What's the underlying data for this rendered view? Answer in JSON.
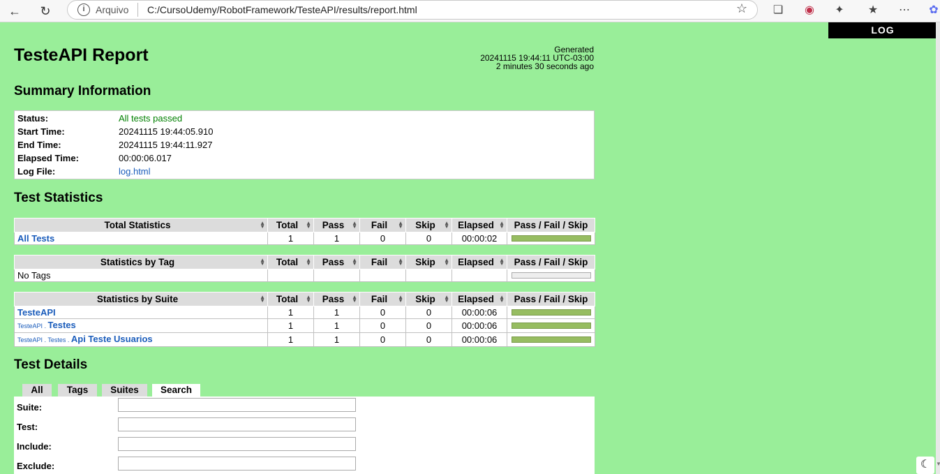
{
  "browser": {
    "url_scheme": "Arquivo",
    "url": "C:/CursoUdemy/RobotFramework/TesteAPI/results/report.html"
  },
  "log_link": "LOG",
  "header": {
    "title": "TesteAPI Report",
    "generated_label": "Generated",
    "generated_time": "20241115 19:44:11 UTC-03:00",
    "generated_ago": "2 minutes 30 seconds ago"
  },
  "summary": {
    "heading": "Summary Information",
    "rows": [
      {
        "label": "Status:",
        "value": "All tests passed"
      },
      {
        "label": "Start Time:",
        "value": "20241115 19:44:05.910"
      },
      {
        "label": "End Time:",
        "value": "20241115 19:44:11.927"
      },
      {
        "label": "Elapsed Time:",
        "value": "00:00:06.017"
      },
      {
        "label": "Log File:",
        "value": "log.html"
      }
    ]
  },
  "statistics": {
    "heading": "Test Statistics",
    "columns": [
      "Total",
      "Pass",
      "Fail",
      "Skip",
      "Elapsed",
      "Pass / Fail / Skip"
    ],
    "total": {
      "title": "Total Statistics",
      "rows": [
        {
          "name": "All Tests",
          "total": "1",
          "pass": "1",
          "fail": "0",
          "skip": "0",
          "elapsed": "00:00:02",
          "pass_ratio": 1
        }
      ]
    },
    "tag": {
      "title": "Statistics by Tag",
      "rows": [
        {
          "name": "No Tags",
          "total": "",
          "pass": "",
          "fail": "",
          "skip": "",
          "elapsed": "",
          "pass_ratio": 0
        }
      ]
    },
    "suite": {
      "title": "Statistics by Suite",
      "rows": [
        {
          "parent": "",
          "name": "TesteAPI",
          "total": "1",
          "pass": "1",
          "fail": "0",
          "skip": "0",
          "elapsed": "00:00:06",
          "pass_ratio": 1
        },
        {
          "parent": "TesteAPI . ",
          "name": "Testes",
          "total": "1",
          "pass": "1",
          "fail": "0",
          "skip": "0",
          "elapsed": "00:00:06",
          "pass_ratio": 1
        },
        {
          "parent": "TesteAPI . Testes . ",
          "name": "Api Teste Usuarios",
          "total": "1",
          "pass": "1",
          "fail": "0",
          "skip": "0",
          "elapsed": "00:00:06",
          "pass_ratio": 1
        }
      ]
    }
  },
  "details": {
    "heading": "Test Details",
    "tabs": [
      "All",
      "Tags",
      "Suites",
      "Search"
    ],
    "active_tab": "Search",
    "search_fields": [
      {
        "label": "Suite:",
        "value": ""
      },
      {
        "label": "Test:",
        "value": ""
      },
      {
        "label": "Include:",
        "value": ""
      },
      {
        "label": "Exclude:",
        "value": ""
      }
    ]
  },
  "colors": {
    "page_background": "#99ee99",
    "pass_bar": "#97bd61",
    "pass_text": "#008000",
    "link": "#1a5cbb"
  }
}
